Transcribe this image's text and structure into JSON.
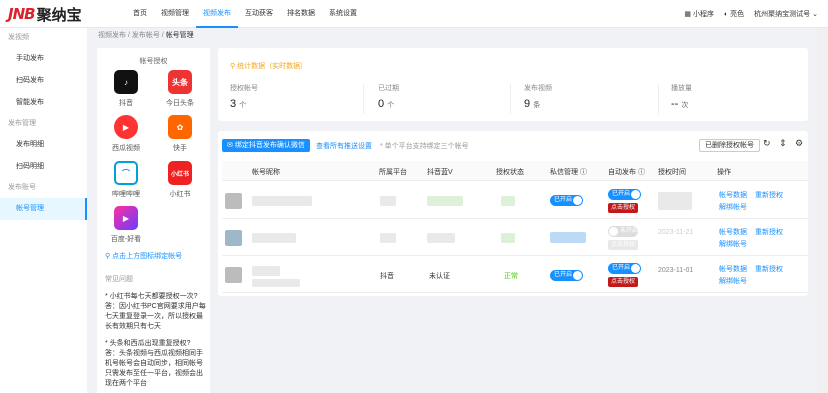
{
  "header": {
    "logo_mark": "JNB",
    "logo_text": "聚纳宝",
    "nav": [
      "首页",
      "视频管理",
      "视频发布",
      "互动获客",
      "排名数据",
      "系统设置"
    ],
    "right": {
      "mini": "小程序",
      "theme": "亮色",
      "account": "杭州聚纳宝测试号"
    }
  },
  "sidebar": {
    "groups": [
      {
        "title": "发视频",
        "items": [
          "手动发布",
          "扫码发布",
          "智能发布"
        ]
      },
      {
        "title": "发布管理",
        "items": [
          "发布明细",
          "扫码明细"
        ]
      },
      {
        "title": "发布账号",
        "items": [
          "帐号管理"
        ]
      }
    ]
  },
  "breadcrumb": [
    "视频发布",
    "发布帐号",
    "帐号管理"
  ],
  "auth_panel": {
    "title": "帐号授权",
    "platforms": [
      "抖音",
      "今日头条",
      "西瓜视频",
      "快手",
      "哔哩哔哩",
      "小红书",
      "百度-好看"
    ],
    "icon_text": {
      "toutiao": "头条",
      "xhs": "小红书"
    },
    "tip": "点击上方图标绑定帐号",
    "faq_title": "常见问题",
    "faq": [
      {
        "q": "小红书每七天都要授权一次?",
        "a": "答：因小红书PC官网要求用户每七天重复登录一次，所以授权最长有效期只有七天"
      },
      {
        "q": "头条和西瓜出现重复授权?",
        "a": "答：头条视频与西瓜视频相同手机号帐号会自动同步，相同帐号只需发布至任一平台，视频会出现在两个平台"
      }
    ]
  },
  "stats": {
    "title": "统计数据（实时数据）",
    "items": [
      {
        "label": "授权帐号",
        "value": "3",
        "unit": "个"
      },
      {
        "label": "已过期",
        "value": "0",
        "unit": "个"
      },
      {
        "label": "发布视频",
        "value": "9",
        "unit": "条"
      },
      {
        "label": "播放量",
        "value": "--",
        "unit": "次"
      }
    ]
  },
  "toolbar": {
    "bind_wechat": "绑定抖音发布确认微信",
    "view_rules": "查看所有推送设置",
    "note": "* 单个平台支持绑定三个帐号",
    "delete_auth": "已删除授权帐号"
  },
  "table": {
    "headers": [
      "帐号昵称",
      "所属平台",
      "抖音蓝V",
      "授权状态",
      "私信管理",
      "自动发布",
      "授权时间",
      "操作"
    ],
    "rows": [
      {
        "platform": "",
        "bluev": "",
        "status": "",
        "dm": "已开启",
        "auto": "已开启",
        "auto_btn": "点击授权",
        "time": "",
        "actions": [
          "帐号数据",
          "重新授权",
          "解绑帐号"
        ]
      },
      {
        "platform": "",
        "bluev": "",
        "status": "",
        "dm": "",
        "auto": "未开启",
        "auto_btn": "点击授权",
        "time": "2023-11-21",
        "actions": [
          "帐号数据",
          "重新授权",
          "解绑帐号"
        ]
      },
      {
        "platform": "抖音",
        "bluev": "未认证",
        "status": "正常",
        "dm": "已开启",
        "auto": "已开启",
        "auto_btn": "点击授权",
        "time": "2023-11-01",
        "actions": [
          "帐号数据",
          "重新授权",
          "解绑帐号"
        ]
      }
    ]
  }
}
